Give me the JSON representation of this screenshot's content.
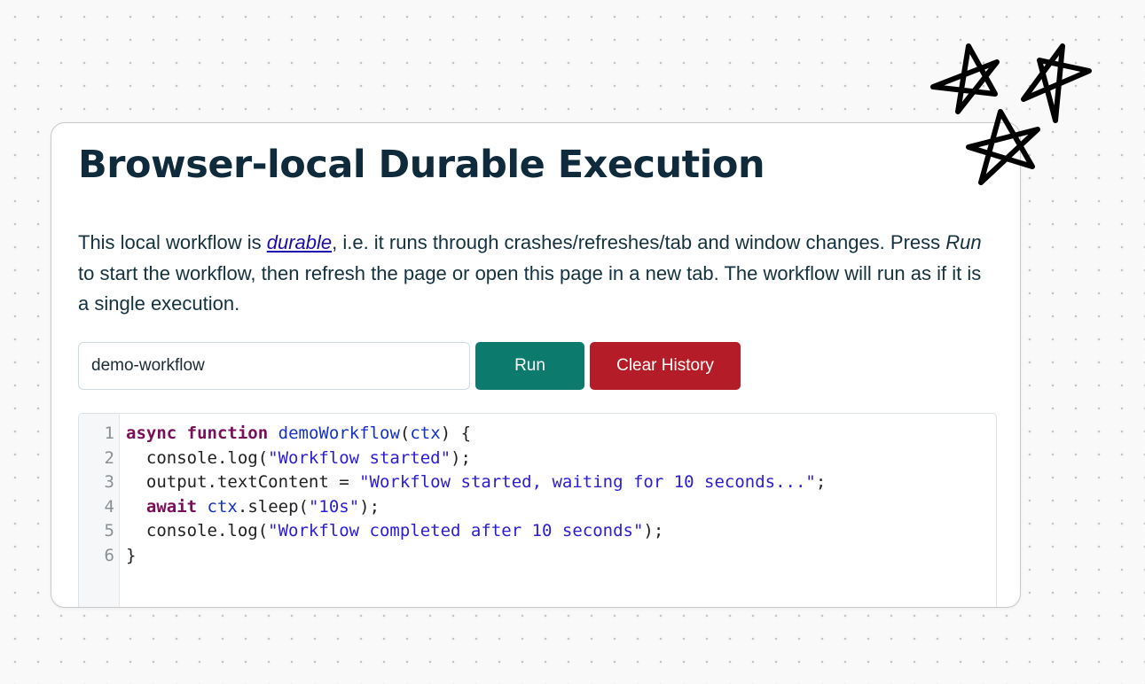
{
  "card": {
    "title": "Browser-local Durable Execution",
    "desc_part1": "This local workflow is ",
    "desc_link": "durable",
    "desc_part2": ", i.e. it runs through crashes/refreshes/tab and window changes. Press ",
    "desc_em": "Run",
    "desc_part3": " to start the workflow, then refresh the page or open this page in a new tab. The workflow will run as if it is a single execution."
  },
  "form": {
    "workflow_name_value": "demo-workflow",
    "run_label": "Run",
    "clear_label": "Clear History"
  },
  "editor": {
    "line_numbers": [
      "1",
      "2",
      "3",
      "4",
      "5",
      "6"
    ],
    "lines": [
      [
        {
          "t": "async",
          "c": "kw"
        },
        {
          "t": " ",
          "c": "var"
        },
        {
          "t": "function",
          "c": "kw"
        },
        {
          "t": " ",
          "c": "var"
        },
        {
          "t": "demoWorkflow",
          "c": "fn"
        },
        {
          "t": "(",
          "c": "var"
        },
        {
          "t": "ctx",
          "c": "fn"
        },
        {
          "t": ") {",
          "c": "var"
        }
      ],
      [
        {
          "t": "  console.log(",
          "c": "var"
        },
        {
          "t": "\"Workflow started\"",
          "c": "str"
        },
        {
          "t": ");",
          "c": "var"
        }
      ],
      [
        {
          "t": "  output.textContent = ",
          "c": "var"
        },
        {
          "t": "\"Workflow started, waiting for 10 seconds...\"",
          "c": "str"
        },
        {
          "t": ";",
          "c": "var"
        }
      ],
      [
        {
          "t": "  ",
          "c": "var"
        },
        {
          "t": "await",
          "c": "kw"
        },
        {
          "t": " ",
          "c": "var"
        },
        {
          "t": "ctx",
          "c": "fn"
        },
        {
          "t": ".sleep(",
          "c": "var"
        },
        {
          "t": "\"10s\"",
          "c": "str"
        },
        {
          "t": ");",
          "c": "var"
        }
      ],
      [
        {
          "t": "  console.log(",
          "c": "var"
        },
        {
          "t": "\"Workflow completed after 10 seconds\"",
          "c": "str"
        },
        {
          "t": ");",
          "c": "var"
        }
      ],
      [
        {
          "t": "}",
          "c": "var"
        }
      ]
    ]
  },
  "decor": {
    "icon": "stars-doodle-icon",
    "color": "#000000"
  },
  "colors": {
    "run_button": "#0c7a6c",
    "clear_button": "#b41d27",
    "title": "#0e2a3b",
    "link": "#1a0dab"
  }
}
